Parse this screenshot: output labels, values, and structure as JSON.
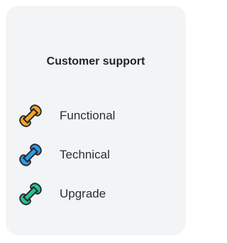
{
  "card": {
    "title": "Customer support"
  },
  "menu": {
    "items": [
      {
        "label": "Functional",
        "icon": "wrench-icon",
        "color": "#F5A623"
      },
      {
        "label": "Technical",
        "icon": "wrench-icon",
        "color": "#2F9BEA"
      },
      {
        "label": "Upgrade",
        "icon": "wrench-icon",
        "color": "#22C39A"
      }
    ]
  },
  "colors": {
    "card_background": "#F3F4F6",
    "text": "#1F2328"
  }
}
